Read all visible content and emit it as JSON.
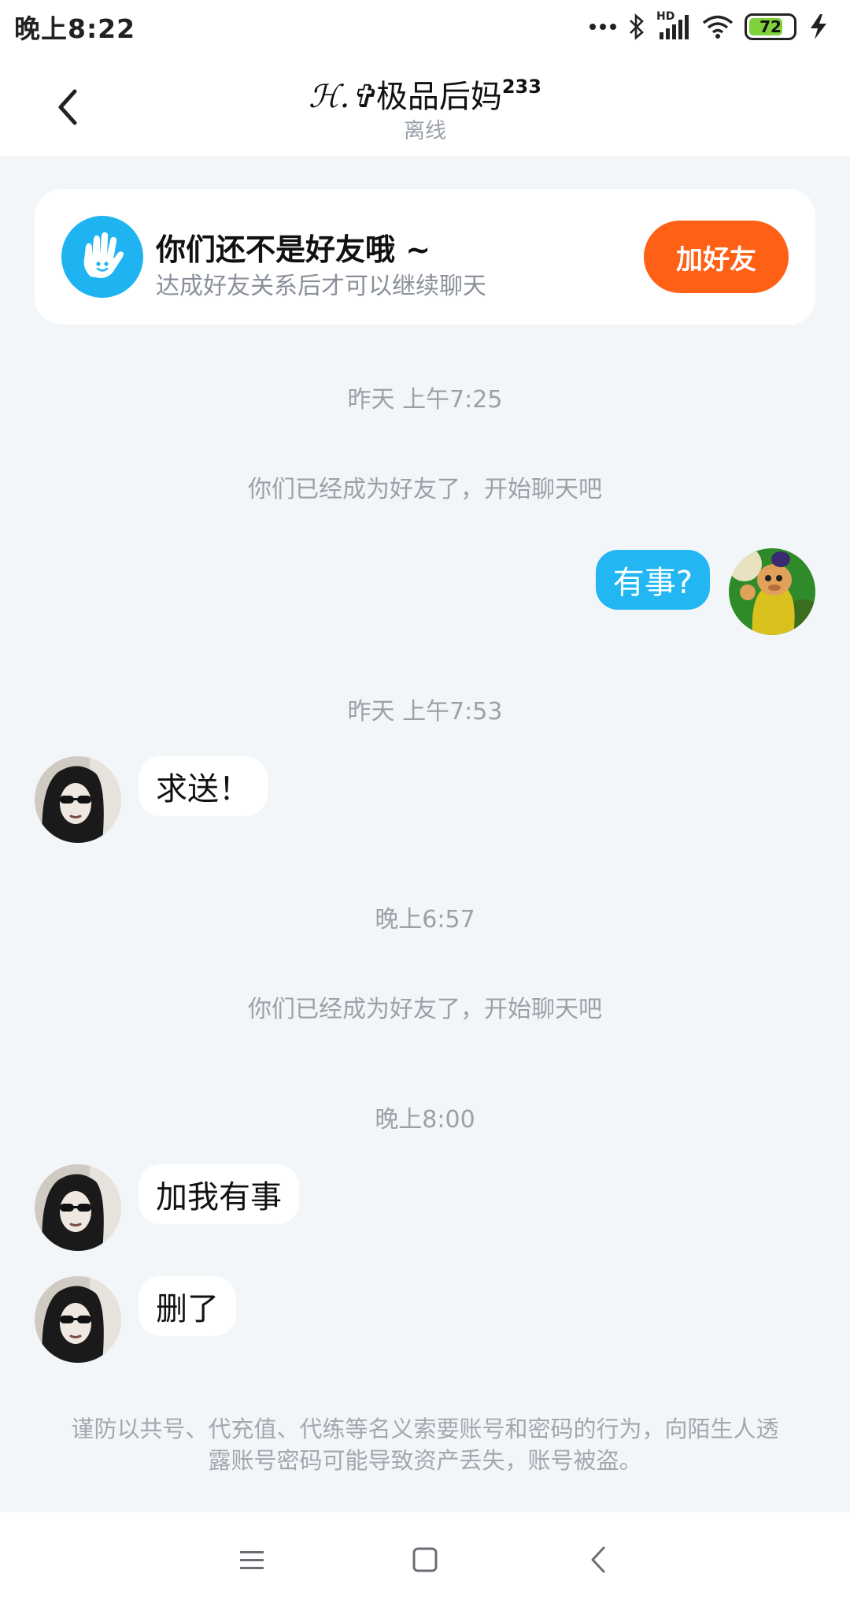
{
  "status_bar": {
    "time": "晚上8:22",
    "signal_label": "HD",
    "battery_level": "72",
    "colors": {
      "battery": "#7fd23b"
    }
  },
  "header": {
    "title_flair": "ℋ.✞",
    "title_name": "极品后妈",
    "title_sup": "233",
    "status": "离线"
  },
  "notice": {
    "icon": "waving-hand-icon",
    "title": "你们还不是好友哦 ~",
    "subtitle": "达成好友关系后才可以继续聊天",
    "add_button": "加好友",
    "colors": {
      "button": "#fe6016",
      "icon_bg": "#1fb4f1"
    }
  },
  "chat": {
    "time_1": "昨天 上午7:25",
    "system_1": "你们已经成为好友了，开始聊天吧",
    "msg_1": "有事?",
    "time_2": "昨天 上午7:53",
    "msg_2": "求送！",
    "time_3": "晚上6:57",
    "system_2": "你们已经成为好友了，开始聊天吧",
    "time_4": "晚上8:00",
    "msg_3": "加我有事",
    "msg_4": "删了",
    "colors": {
      "outgoing_bubble": "#22b7f3",
      "incoming_bubble": "#ffffff"
    }
  },
  "footer": {
    "warning": "谨防以共号、代充值、代练等名义索要账号和密码的行为，向陌生人透露账号密码可能导致资产丢失，账号被盗。"
  },
  "nav": {
    "icons": [
      "menu-icon",
      "home-icon",
      "back-icon"
    ]
  }
}
